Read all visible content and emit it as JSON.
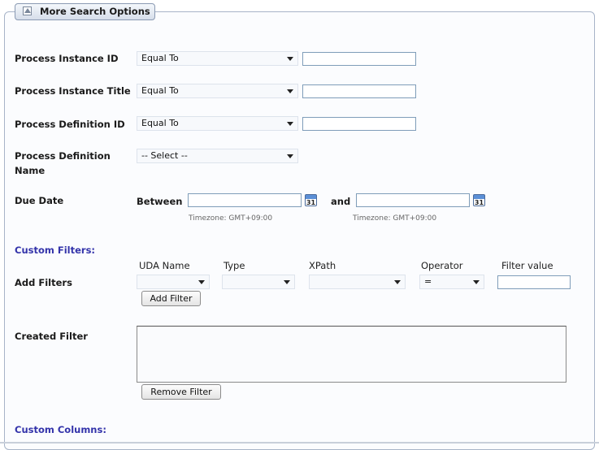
{
  "toggle": {
    "label": "More Search Options",
    "icon": "collapse-up-icon"
  },
  "fields": {
    "process_instance_id": {
      "label": "Process Instance ID",
      "operator": "Equal To",
      "value": ""
    },
    "process_instance_title": {
      "label": "Process Instance Title",
      "operator": "Equal To",
      "value": ""
    },
    "process_definition_id": {
      "label": "Process Definition ID",
      "operator": "Equal To",
      "value": ""
    },
    "process_definition_name": {
      "label_line1": "Process Definition",
      "label_line2": "Name",
      "selected": "-- Select --"
    }
  },
  "due_date": {
    "label": "Due Date",
    "between_label": "Between",
    "and_label": "and",
    "from_value": "",
    "to_value": "",
    "calendar_icon_text": "31",
    "timezone_from": "Timezone: GMT+09:00",
    "timezone_to": "Timezone: GMT+09:00"
  },
  "custom_filters": {
    "section_title": "Custom Filters:",
    "add_filters_label": "Add Filters",
    "columns": [
      "UDA Name",
      "Type",
      "XPath",
      "Operator",
      "Filter value"
    ],
    "uda_name": "",
    "type": "",
    "xpath": "",
    "operator": "=",
    "filter_value": "",
    "add_button": "Add Filter"
  },
  "created_filter": {
    "label": "Created Filter",
    "remove_button": "Remove Filter"
  },
  "custom_columns": {
    "section_title": "Custom Columns:"
  },
  "colors": {
    "section_title": "#3333aa",
    "panel_border": "#a7b4c8"
  }
}
